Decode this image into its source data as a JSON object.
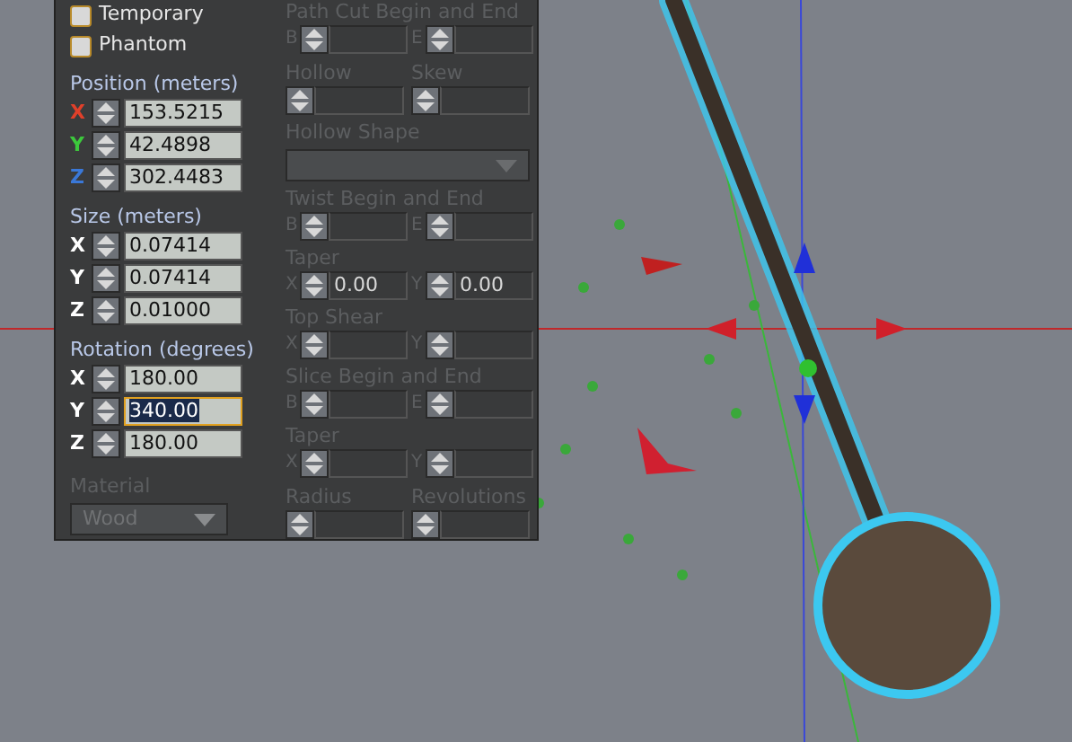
{
  "options": [
    {
      "label": "Temporary",
      "checked": false
    },
    {
      "label": "Phantom",
      "checked": false
    }
  ],
  "groups": [
    {
      "title": "Position (meters)",
      "fields": [
        {
          "axis": "X",
          "color": "#e0402a",
          "value": "153.5215",
          "focused": false
        },
        {
          "axis": "Y",
          "color": "#3cc83c",
          "value": "42.4898",
          "focused": false
        },
        {
          "axis": "Z",
          "color": "#3a78d8",
          "value": "302.4483",
          "focused": false
        }
      ]
    },
    {
      "title": "Size (meters)",
      "fields": [
        {
          "axis": "X",
          "color": "#ffffff",
          "value": "0.07414",
          "focused": false
        },
        {
          "axis": "Y",
          "color": "#ffffff",
          "value": "0.07414",
          "focused": false
        },
        {
          "axis": "Z",
          "color": "#ffffff",
          "value": "0.01000",
          "focused": false
        }
      ]
    },
    {
      "title": "Rotation (degrees)",
      "fields": [
        {
          "axis": "X",
          "color": "#ffffff",
          "value": "180.00",
          "focused": false
        },
        {
          "axis": "Y",
          "color": "#ffffff",
          "value": "340.00",
          "focused": true
        },
        {
          "axis": "Z",
          "color": "#ffffff",
          "value": "180.00",
          "focused": false
        }
      ]
    }
  ],
  "material": {
    "label": "Material",
    "value": "Wood",
    "disabled": true
  },
  "shape_sections": [
    {
      "kind": "pair",
      "title": "Path Cut Begin and End",
      "disabled": true,
      "fields": [
        {
          "prefix": "B"
        },
        {
          "prefix": "E"
        }
      ]
    },
    {
      "kind": "split",
      "disabled": true,
      "fields": [
        {
          "title": "Hollow"
        },
        {
          "title": "Skew"
        }
      ]
    },
    {
      "kind": "dropdown",
      "title": "Hollow Shape",
      "disabled": true
    },
    {
      "kind": "pair",
      "title": "Twist Begin and End",
      "disabled": true,
      "fields": [
        {
          "prefix": "B"
        },
        {
          "prefix": "E"
        }
      ]
    },
    {
      "kind": "pair",
      "title": "Taper",
      "disabled": true,
      "fields": [
        {
          "prefix": "X",
          "value": "0.00"
        },
        {
          "prefix": "Y",
          "value": "0.00"
        }
      ]
    },
    {
      "kind": "pair",
      "title": "Top Shear",
      "disabled": true,
      "fields": [
        {
          "prefix": "X"
        },
        {
          "prefix": "Y"
        }
      ]
    },
    {
      "kind": "pair",
      "title": "Slice Begin and End",
      "disabled": true,
      "fields": [
        {
          "prefix": "B"
        },
        {
          "prefix": "E"
        }
      ]
    },
    {
      "kind": "pair",
      "title": "Taper",
      "disabled": true,
      "fields": [
        {
          "prefix": "X"
        },
        {
          "prefix": "Y"
        }
      ]
    },
    {
      "kind": "split",
      "disabled": true,
      "fields": [
        {
          "title": "Radius"
        },
        {
          "title": "Revolutions"
        }
      ]
    }
  ]
}
